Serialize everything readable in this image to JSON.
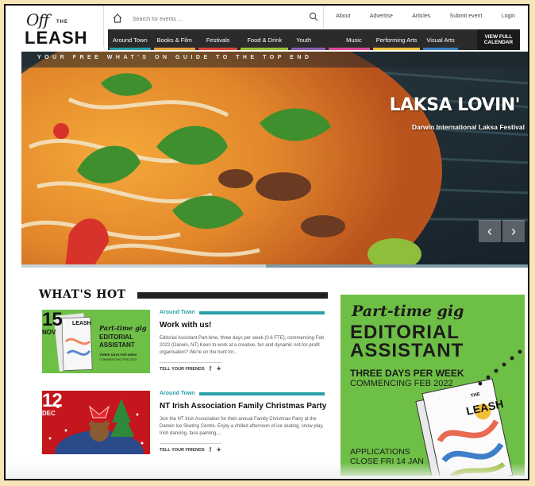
{
  "header": {
    "logo": {
      "off": "Off",
      "the": "THE",
      "leash": "LEASH"
    },
    "search": {
      "placeholder": "Search for events ..."
    },
    "top_links": [
      "About",
      "Advertise",
      "Articles",
      "Submit event",
      "Login"
    ],
    "nav": [
      {
        "label": "Around Town",
        "color": "#2aa0a8"
      },
      {
        "label": "Books & Film",
        "color": "#e8a33d"
      },
      {
        "label": "Festivals",
        "color": "#d8453b"
      },
      {
        "label": "Food & Drink",
        "color": "#9bbf3b"
      },
      {
        "label": "Youth",
        "color": "#8d5fb0"
      },
      {
        "label": "Music",
        "color": "#e0489a"
      },
      {
        "label": "Performing Arts",
        "color": "#f0c23a"
      },
      {
        "label": "Visual Arts",
        "color": "#3a82c4"
      }
    ],
    "calendar_label_1": "VIEW FULL",
    "calendar_label_2": "CALENDAR"
  },
  "hero": {
    "tagline": "YOUR FREE WHAT'S ON GUIDE TO THE TOP END",
    "title": "LAKSA LOVIN'",
    "subtitle": "Darwin International Laksa Festival",
    "slide_progress": 0.48
  },
  "whats_hot": {
    "title": "WHAT'S HOT",
    "articles": [
      {
        "day": "15",
        "month": "NOV",
        "category": "Around Town",
        "title": "Work with us!",
        "excerpt": "Editorial Assistant Part-time, three days per week (0.6 FTE), commencing Feb 2022 (Darwin, NT) Keen to work at a creative, fun and dynamic not-for-profit organisation? We're on the hunt for...",
        "share_label": "TELL YOUR FRIENDS",
        "thumb": {
          "leash": "LEASH",
          "l1": "Part-time gig",
          "l2": "EDITORIAL",
          "l3": "ASSISTANT",
          "l4": "THREE DAYS PER WEEK",
          "l5": "COMMENCING FEB 2022"
        }
      },
      {
        "day": "12",
        "month": "DEC",
        "category": "Around Town",
        "title": "NT Irish Association Family Christmas Party",
        "excerpt": "Join the NT Irish Association for their annual Family Christmas Party at the Darwin Ice Skating Centre. Enjoy a chilled afternoon of ice skating, snow play, Irish dancing, face painting,...",
        "share_label": "TELL YOUR FRIENDS"
      }
    ]
  },
  "ad": {
    "line1": "Part-time gig",
    "line2a": "EDITORIAL",
    "line2b": "ASSISTANT",
    "line3": "THREE DAYS PER WEEK",
    "line4": "COMMENCING FEB 2022",
    "line5a": "APPLICATIONS",
    "line5b": "CLOSE FRI 14 JAN",
    "mag_the": "THE",
    "mag_leash": "LEASH"
  }
}
